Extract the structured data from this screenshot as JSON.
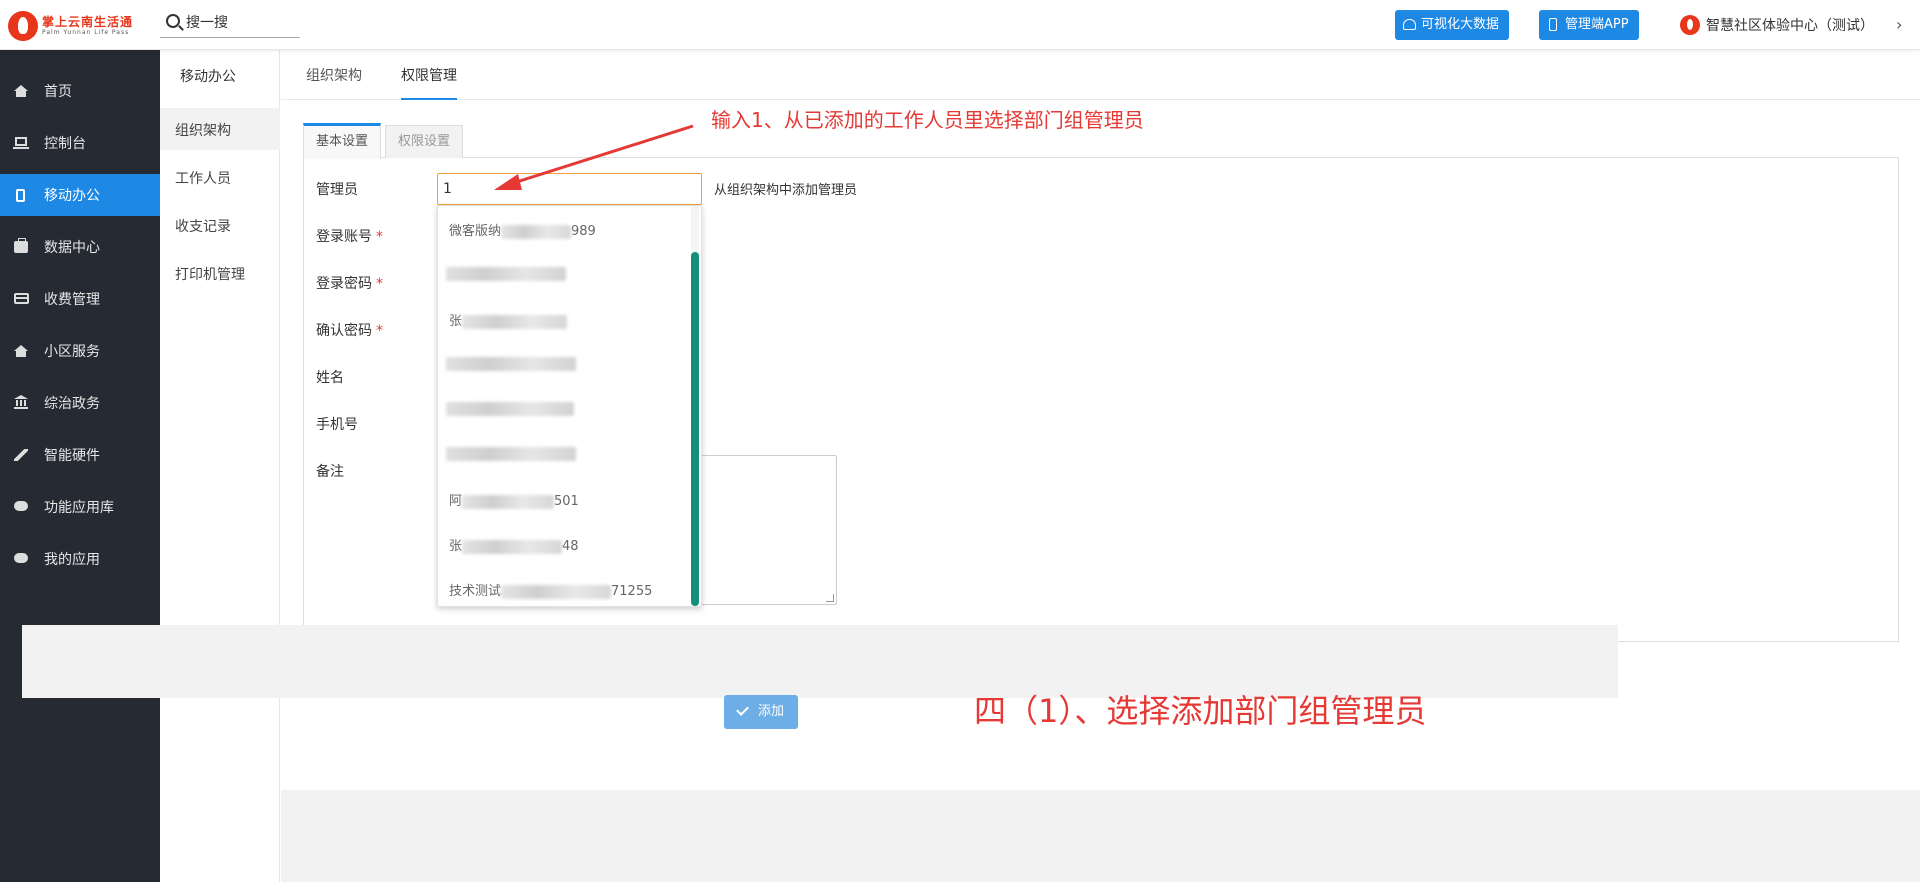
{
  "header": {
    "logo_text": "掌上云南生活通",
    "logo_sub": "Palm Yunnan Life Pass",
    "search_placeholder": "搜一搜",
    "btn_bigdata": "可视化大数据",
    "btn_app": "管理端APP",
    "user_name": "智慧社区体验中心（测试）",
    "user_chevron": "›"
  },
  "sidebar": {
    "items": [
      {
        "label": "首页",
        "icon": "home-icon"
      },
      {
        "label": "控制台",
        "icon": "laptop-icon"
      },
      {
        "label": "移动办公",
        "icon": "tablet-icon"
      },
      {
        "label": "数据中心",
        "icon": "briefcase-icon"
      },
      {
        "label": "收费管理",
        "icon": "credit-card-icon"
      },
      {
        "label": "小区服务",
        "icon": "home-icon"
      },
      {
        "label": "综治政务",
        "icon": "bank-icon"
      },
      {
        "label": "智能硬件",
        "icon": "wrench-icon"
      },
      {
        "label": "功能应用库",
        "icon": "cloud-download-icon"
      },
      {
        "label": "我的应用",
        "icon": "cloud-icon"
      }
    ],
    "active_index": 2
  },
  "subbar": {
    "title": "移动办公",
    "items": [
      "组织架构",
      "工作人员",
      "收支记录",
      "打印机管理"
    ]
  },
  "tabs": [
    "组织架构",
    "权限管理"
  ],
  "form": {
    "inner_tabs": [
      "基本设置",
      "权限设置"
    ],
    "labels": {
      "admin": "管理员",
      "account": "登录账号",
      "password": "登录密码",
      "confirm": "确认密码",
      "name": "姓名",
      "phone": "手机号",
      "remark": "备注"
    },
    "required_mark": "*",
    "admin_value": "1",
    "admin_hint": "从组织架构中添加管理员"
  },
  "dropdown": {
    "items": [
      {
        "prefix": "微客版纳",
        "suffix": "989"
      },
      {
        "prefix": "",
        "suffix": ""
      },
      {
        "prefix": "张",
        "suffix": ""
      },
      {
        "prefix": "",
        "suffix": ""
      },
      {
        "prefix": "",
        "suffix": ""
      },
      {
        "prefix": "",
        "suffix": ""
      },
      {
        "prefix": "阿",
        "suffix": "501"
      },
      {
        "prefix": "张",
        "suffix": "48"
      },
      {
        "prefix": "技术测试",
        "suffix": "71255"
      }
    ]
  },
  "add_button": "添加",
  "annotations": {
    "top": "输入1、从已添加的工作人员里选择部门组管理员",
    "bottom": "四（1）、选择添加部门组管理员"
  },
  "colors": {
    "primary": "#1e88e5",
    "sidebar_bg": "#252a33",
    "annotation": "#e53935",
    "scroll": "#14907a",
    "input_focus": "#f0a33c"
  }
}
